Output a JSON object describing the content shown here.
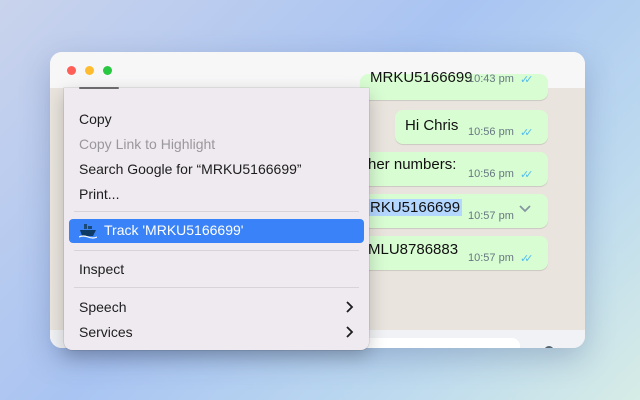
{
  "window": {
    "traffic_lights": {
      "close": "#ff5f57",
      "minimize": "#febc2e",
      "zoom": "#28c840"
    }
  },
  "chat": {
    "messages": [
      {
        "text": "MRKU5166699",
        "time": "10:43 pm",
        "clipped": true
      },
      {
        "text": "Hi Chris",
        "time": "10:56 pm"
      },
      {
        "text": "her numbers:",
        "time": "10:56 pm"
      },
      {
        "text": "RKU5166699",
        "time": "10:57 pm",
        "highlighted": true,
        "has_dropdown": true
      },
      {
        "text": "MLU8786883",
        "time": "10:57 pm"
      }
    ],
    "read_ticks": "✓✓"
  },
  "context_menu": {
    "items": {
      "copy": "Copy",
      "copy_link": "Copy Link to Highlight",
      "search": "Search Google for “MRKU5166699”",
      "print": "Print...",
      "track": "Track 'MRKU5166699'",
      "inspect": "Inspect",
      "speech": "Speech",
      "services": "Services"
    }
  },
  "colors": {
    "selection": "#3a82f7",
    "bubble": "#d9fdd3",
    "text_highlight": "#b3d7ff"
  }
}
